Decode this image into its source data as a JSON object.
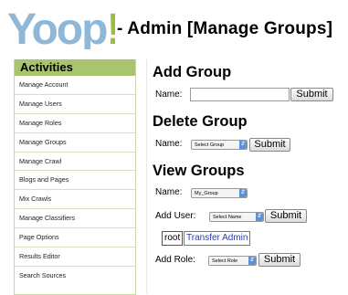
{
  "header": {
    "logo_text": "Yoop!",
    "title": "- Admin [Manage Groups]"
  },
  "sidebar": {
    "heading": "Activities",
    "items": [
      "Manage Account",
      "Manage Users",
      "Manage Roles",
      "Manage Groups",
      "Manage Crawl",
      "Blogs and Pages",
      "Mix Crawls",
      "Manage Classifiers",
      "Page Options",
      "Results Editor",
      "Search Sources"
    ]
  },
  "add_group": {
    "heading": "Add Group",
    "name_label": "Name:",
    "name_value": "",
    "submit_label": "Submit"
  },
  "delete_group": {
    "heading": "Delete Group",
    "name_label": "Name:",
    "select_value": "Select Group",
    "submit_label": "Submit"
  },
  "view_groups": {
    "heading": "View Groups",
    "name_label": "Name:",
    "group_select_value": "My_Group",
    "add_user_label": "Add User:",
    "user_select_value": "Select Name",
    "add_user_submit_label": "Submit",
    "member_name": "root",
    "transfer_admin_label": "Transfer Admin",
    "add_role_label": "Add Role:",
    "role_select_value": "Select Role",
    "add_role_submit_label": "Submit"
  },
  "colors": {
    "logo_blue": "#8fb8d8",
    "logo_green": "#9bbf3a",
    "sidebar_header": "#a9c46e",
    "link": "#2a3fa8"
  }
}
